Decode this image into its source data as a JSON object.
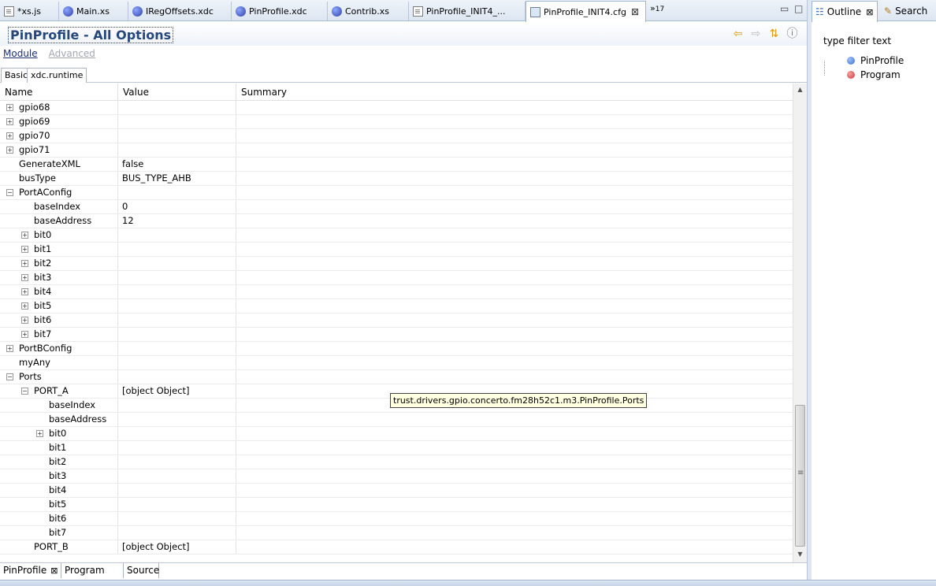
{
  "editor_tabs": [
    {
      "label": "*xs.js",
      "icon": "file-icon"
    },
    {
      "label": "Main.xs",
      "icon": "globe-icon"
    },
    {
      "label": "IRegOffsets.xdc",
      "icon": "globe-icon"
    },
    {
      "label": "PinProfile.xdc",
      "icon": "globe-icon"
    },
    {
      "label": "Contrib.xs",
      "icon": "globe-icon"
    },
    {
      "label": "PinProfile_INIT4_...",
      "icon": "file-icon"
    },
    {
      "label": "PinProfile_INIT4.cfg",
      "icon": "cfg-icon",
      "active": true,
      "close": "⊠"
    }
  ],
  "overflow": {
    "glyph": "»",
    "count": "17"
  },
  "header": {
    "title": "PinProfile - All Options",
    "module_link": "Module",
    "advanced_link": "Advanced"
  },
  "inner_tabs": [
    "Basic",
    "xdc.runtime"
  ],
  "columns": {
    "name": "Name",
    "value": "Value",
    "summary": "Summary"
  },
  "rows": [
    {
      "name": "gpio68",
      "value": "",
      "exp": "+",
      "level": 0
    },
    {
      "name": "gpio69",
      "value": "",
      "exp": "+",
      "level": 0
    },
    {
      "name": "gpio70",
      "value": "",
      "exp": "+",
      "level": 0
    },
    {
      "name": "gpio71",
      "value": "",
      "exp": "+",
      "level": 0
    },
    {
      "name": "GenerateXML",
      "value": "false",
      "exp": "",
      "level": 0
    },
    {
      "name": "busType",
      "value": "BUS_TYPE_AHB",
      "exp": "",
      "level": 0
    },
    {
      "name": "PortAConfig",
      "value": "",
      "exp": "−",
      "level": 0
    },
    {
      "name": "baseIndex",
      "value": "0",
      "exp": "",
      "level": 1
    },
    {
      "name": "baseAddress",
      "value": "12",
      "exp": "",
      "level": 1
    },
    {
      "name": "bit0",
      "value": "",
      "exp": "+",
      "level": 1
    },
    {
      "name": "bit1",
      "value": "",
      "exp": "+",
      "level": 1
    },
    {
      "name": "bit2",
      "value": "",
      "exp": "+",
      "level": 1
    },
    {
      "name": "bit3",
      "value": "",
      "exp": "+",
      "level": 1
    },
    {
      "name": "bit4",
      "value": "",
      "exp": "+",
      "level": 1
    },
    {
      "name": "bit5",
      "value": "",
      "exp": "+",
      "level": 1
    },
    {
      "name": "bit6",
      "value": "",
      "exp": "+",
      "level": 1
    },
    {
      "name": "bit7",
      "value": "",
      "exp": "+",
      "level": 1
    },
    {
      "name": "PortBConfig",
      "value": "",
      "exp": "+",
      "level": 0
    },
    {
      "name": "myAny",
      "value": "",
      "exp": "",
      "level": 0
    },
    {
      "name": "Ports",
      "value": "",
      "exp": "−",
      "level": 0
    },
    {
      "name": "PORT_A",
      "value": "[object Object]",
      "exp": "−",
      "level": 1
    },
    {
      "name": "baseIndex",
      "value": "",
      "exp": "",
      "level": 2
    },
    {
      "name": "baseAddress",
      "value": "",
      "exp": "",
      "level": 2
    },
    {
      "name": "bit0",
      "value": "",
      "exp": "+",
      "level": 2
    },
    {
      "name": "bit1",
      "value": "",
      "exp": "",
      "level": 2
    },
    {
      "name": "bit2",
      "value": "",
      "exp": "",
      "level": 2
    },
    {
      "name": "bit3",
      "value": "",
      "exp": "",
      "level": 2
    },
    {
      "name": "bit4",
      "value": "",
      "exp": "",
      "level": 2
    },
    {
      "name": "bit5",
      "value": "",
      "exp": "",
      "level": 2
    },
    {
      "name": "bit6",
      "value": "",
      "exp": "",
      "level": 2
    },
    {
      "name": "bit7",
      "value": "",
      "exp": "",
      "level": 2
    },
    {
      "name": "PORT_B",
      "value": "[object Object]",
      "exp": "",
      "level": 1
    }
  ],
  "tooltip": "trust.drivers.gpio.concerto.fm28h52c1.m3.PinProfile.Ports",
  "bottom_tabs": [
    {
      "label": "PinProfile",
      "close": "⊠"
    },
    {
      "label": "Program"
    },
    {
      "label": "Source"
    }
  ],
  "outline": {
    "tabs": [
      {
        "label": "Outline",
        "close": "⊠"
      },
      {
        "label": "Search"
      }
    ],
    "filter_text": "type filter text",
    "items": [
      {
        "label": "PinProfile",
        "color": "#3b6fc4"
      },
      {
        "label": "Program",
        "color": "#c43b3b"
      }
    ]
  }
}
